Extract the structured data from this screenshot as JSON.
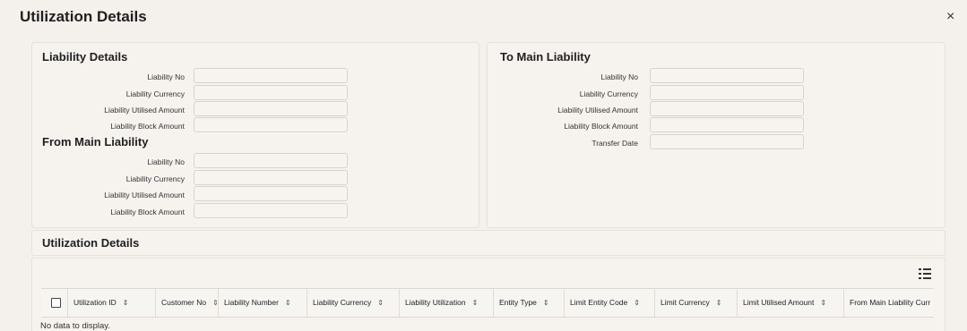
{
  "window": {
    "title": "Utilization Details",
    "close_label": "×"
  },
  "liability_details": {
    "title": "Liability Details",
    "fields": [
      {
        "label": "Liability No",
        "value": ""
      },
      {
        "label": "Liability Currency",
        "value": ""
      },
      {
        "label": "Liability Utilised Amount",
        "value": ""
      },
      {
        "label": "Liability Block Amount",
        "value": ""
      }
    ]
  },
  "from_main_liability": {
    "title": "From Main Liability",
    "fields": [
      {
        "label": "Liability No",
        "value": ""
      },
      {
        "label": "Liability Currency",
        "value": ""
      },
      {
        "label": "Liability Utilised Amount",
        "value": ""
      },
      {
        "label": "Liability Block Amount",
        "value": ""
      }
    ]
  },
  "to_main_liability": {
    "title": "To Main Liability",
    "fields": [
      {
        "label": "Liability No",
        "value": ""
      },
      {
        "label": "Liability Currency",
        "value": ""
      },
      {
        "label": "Liability Utilised Amount",
        "value": ""
      },
      {
        "label": "Liability Block Amount",
        "value": ""
      },
      {
        "label": "Transfer Date",
        "value": ""
      }
    ]
  },
  "utilization_section": {
    "title": "Utilization Details"
  },
  "grid": {
    "columns": [
      "Utilization ID",
      "Customer No",
      "Liability Number",
      "Liability Currency",
      "Liability Utilization",
      "Entity Type",
      "Limit Entity Code",
      "Limit Currency",
      "Limit Utilised Amount",
      "From Main Liability Curr"
    ],
    "sort_icon": "⇕",
    "empty_message": "No data to display."
  }
}
